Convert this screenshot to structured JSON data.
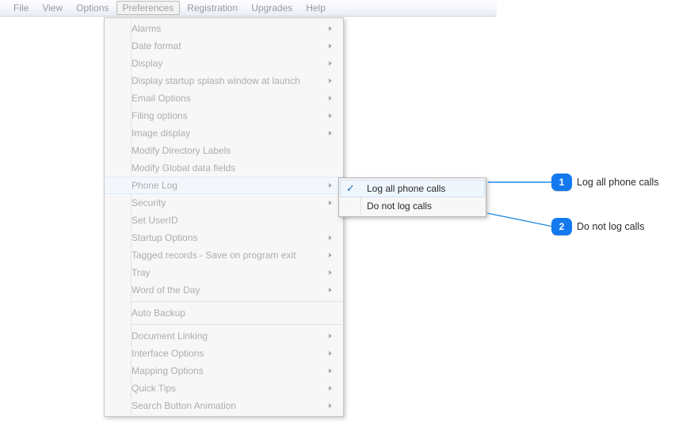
{
  "menubar": {
    "items": [
      {
        "label": "File",
        "active": false
      },
      {
        "label": "View",
        "active": false
      },
      {
        "label": "Options",
        "active": false
      },
      {
        "label": "Preferences",
        "active": true
      },
      {
        "label": "Registration",
        "active": false
      },
      {
        "label": "Upgrades",
        "active": false
      },
      {
        "label": "Help",
        "active": false
      }
    ]
  },
  "preferences_menu": {
    "items": [
      {
        "label": "Alarms",
        "submenu": true,
        "separator_after": false,
        "highlighted": false
      },
      {
        "label": "Date format",
        "submenu": true,
        "separator_after": false,
        "highlighted": false
      },
      {
        "label": "Display",
        "submenu": true,
        "separator_after": false,
        "highlighted": false
      },
      {
        "label": "Display startup splash window at launch",
        "submenu": true,
        "separator_after": false,
        "highlighted": false
      },
      {
        "label": "Email Options",
        "submenu": true,
        "separator_after": false,
        "highlighted": false
      },
      {
        "label": "Filing options",
        "submenu": true,
        "separator_after": false,
        "highlighted": false
      },
      {
        "label": "Image display",
        "submenu": true,
        "separator_after": false,
        "highlighted": false
      },
      {
        "label": "Modify Directory Labels",
        "submenu": false,
        "separator_after": false,
        "highlighted": false
      },
      {
        "label": "Modify Global data fields",
        "submenu": false,
        "separator_after": false,
        "highlighted": false
      },
      {
        "label": "Phone Log",
        "submenu": true,
        "separator_after": false,
        "highlighted": true
      },
      {
        "label": "Security",
        "submenu": true,
        "separator_after": false,
        "highlighted": false
      },
      {
        "label": "Set UserID",
        "submenu": false,
        "separator_after": false,
        "highlighted": false
      },
      {
        "label": "Startup Options",
        "submenu": true,
        "separator_after": false,
        "highlighted": false
      },
      {
        "label": "Tagged records - Save on program exit",
        "submenu": true,
        "separator_after": false,
        "highlighted": false
      },
      {
        "label": "Tray",
        "submenu": true,
        "separator_after": false,
        "highlighted": false
      },
      {
        "label": "Word of the Day",
        "submenu": true,
        "separator_after": true,
        "highlighted": false
      },
      {
        "label": "Auto Backup",
        "submenu": false,
        "separator_after": true,
        "highlighted": false
      },
      {
        "label": "Document Linking",
        "submenu": true,
        "separator_after": false,
        "highlighted": false
      },
      {
        "label": "Interface Options",
        "submenu": true,
        "separator_after": false,
        "highlighted": false
      },
      {
        "label": "Mapping Options",
        "submenu": true,
        "separator_after": false,
        "highlighted": false
      },
      {
        "label": "Quick Tips",
        "submenu": true,
        "separator_after": false,
        "highlighted": false
      },
      {
        "label": "Search Button Animation",
        "submenu": true,
        "separator_after": false,
        "highlighted": false
      }
    ]
  },
  "phone_log_submenu": {
    "items": [
      {
        "label": "Log all phone calls",
        "checked": true,
        "check_glyph": "✓",
        "highlighted": true
      },
      {
        "label": "Do not log calls",
        "checked": false,
        "check_glyph": "",
        "highlighted": false
      }
    ]
  },
  "callouts": [
    {
      "number": "1",
      "text": "Log all phone calls"
    },
    {
      "number": "2",
      "text": "Do not log calls"
    }
  ],
  "colors": {
    "accent": "#1479ef",
    "leader_line": "#2189e0",
    "check_mark": "#1569c7",
    "menu_bg": "#f7f7f7",
    "disabled_text": "#adadb2"
  }
}
